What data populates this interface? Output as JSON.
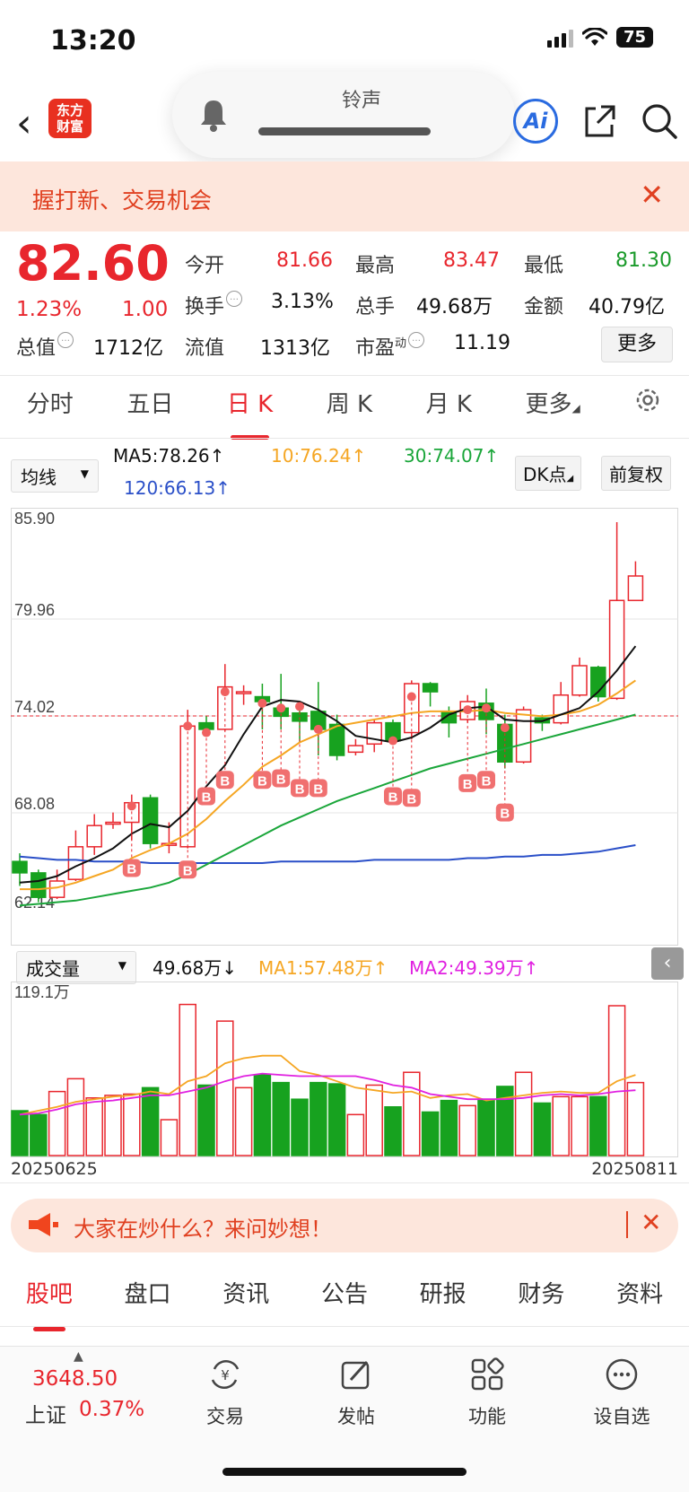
{
  "status": {
    "time": "13:20",
    "battery": "75"
  },
  "header": {
    "logo_line1": "东方",
    "logo_line2": "财富",
    "ringer_label": "铃声",
    "ai_label": "Ai"
  },
  "banner": {
    "text": "握打新、交易机会"
  },
  "quote": {
    "price": "82.60",
    "pct": "1.23%",
    "change": "1.00",
    "open_label": "今开",
    "open": "81.66",
    "high_label": "最高",
    "high": "83.47",
    "low_label": "最低",
    "low": "81.30",
    "turnover_label": "换手",
    "turnover": "3.13%",
    "volume_label": "总手",
    "volume": "49.68万",
    "amount_label": "金额",
    "amount": "40.79亿",
    "mktcap_label": "总值",
    "mktcap": "1712亿",
    "float_label": "流值",
    "float": "1313亿",
    "pe_label": "市盈",
    "pe_sup": "动",
    "pe": "11.19",
    "more": "更多"
  },
  "tabs": [
    {
      "label": "分时"
    },
    {
      "label": "五日"
    },
    {
      "label": "日 K"
    },
    {
      "label": "周 K"
    },
    {
      "label": "月 K"
    },
    {
      "label": "更多"
    }
  ],
  "chart_ctrl": {
    "ma_select": "均线",
    "ma5": "MA5:78.26↑",
    "ma10": "10:76.24↑",
    "ma30": "30:74.07↑",
    "ma120": "120:66.13↑",
    "dk": "DK点",
    "adjust": "前复权"
  },
  "colors": {
    "up": "#e8262d",
    "down": "#17a21f",
    "ma5": "#111111",
    "ma10": "#f5a623",
    "ma30": "#1aa63a",
    "ma120": "#2a4fc8",
    "vma2": "#e020e0"
  },
  "chart_data": {
    "type": "candlestick",
    "price_axis": {
      "ticks": [
        "85.90",
        "79.96",
        "74.02",
        "68.08",
        "62.14"
      ],
      "ylim": [
        62.14,
        85.9
      ],
      "ref_price": 74.02
    },
    "candles": [
      [
        65.1,
        64.4,
        63.6,
        65.6
      ],
      [
        64.4,
        62.9,
        62.6,
        64.6
      ],
      [
        62.9,
        63.9,
        62.8,
        64.6
      ],
      [
        64.0,
        66.0,
        63.9,
        67.0
      ],
      [
        66.0,
        67.3,
        65.5,
        68.0
      ],
      [
        67.4,
        67.5,
        67.1,
        68.1
      ],
      [
        67.5,
        68.7,
        66.4,
        69.2
      ],
      [
        69.0,
        66.2,
        65.9,
        69.2
      ],
      [
        66.2,
        66.2,
        65.6,
        67.5
      ],
      [
        66.0,
        73.4,
        65.9,
        74.4
      ],
      [
        73.6,
        73.2,
        72.9,
        74.0
      ],
      [
        73.2,
        75.8,
        73.1,
        77.2
      ],
      [
        75.5,
        75.5,
        74.7,
        75.9
      ],
      [
        75.2,
        74.9,
        73.2,
        76.0
      ],
      [
        74.5,
        74.0,
        73.2,
        76.6
      ],
      [
        74.2,
        73.7,
        72.4,
        74.6
      ],
      [
        74.3,
        73.2,
        71.6,
        76.1
      ],
      [
        73.5,
        71.6,
        71.3,
        74.1
      ],
      [
        71.8,
        72.2,
        71.6,
        72.6
      ],
      [
        72.3,
        73.6,
        71.8,
        73.8
      ],
      [
        73.6,
        72.5,
        72.3,
        73.8
      ],
      [
        73.0,
        76.0,
        72.6,
        76.2
      ],
      [
        76.0,
        75.5,
        74.6,
        76.1
      ],
      [
        74.3,
        73.6,
        72.7,
        74.6
      ],
      [
        73.8,
        74.9,
        73.6,
        75.3
      ],
      [
        74.8,
        73.8,
        72.9,
        75.7
      ],
      [
        73.5,
        71.2,
        70.8,
        74.1
      ],
      [
        71.2,
        74.4,
        71.1,
        74.6
      ],
      [
        73.9,
        73.6,
        73.1,
        74.1
      ],
      [
        73.6,
        75.3,
        73.5,
        76.1
      ],
      [
        75.3,
        77.1,
        75.2,
        77.6
      ],
      [
        77.0,
        75.2,
        74.9,
        77.1
      ],
      [
        75.1,
        81.1,
        75.0,
        85.9
      ],
      [
        81.1,
        82.6,
        81.3,
        83.5
      ]
    ],
    "ma5": [
      63.8,
      63.9,
      64.2,
      64.8,
      65.3,
      65.9,
      66.8,
      67.4,
      67.2,
      68.2,
      69.7,
      71.0,
      72.9,
      74.6,
      75.0,
      74.9,
      74.4,
      73.7,
      72.8,
      72.6,
      72.4,
      72.7,
      73.3,
      74.1,
      74.5,
      74.6,
      73.8,
      73.7,
      73.7,
      74.1,
      74.5,
      75.5,
      76.8,
      78.3
    ],
    "ma10": [
      63.4,
      63.4,
      63.5,
      63.8,
      64.2,
      64.6,
      65.3,
      65.8,
      66.2,
      66.8,
      67.7,
      68.8,
      69.8,
      70.9,
      71.6,
      72.4,
      72.9,
      73.4,
      73.6,
      73.8,
      74.0,
      74.2,
      74.3,
      74.3,
      74.3,
      74.4,
      74.2,
      74.1,
      74.0,
      74.1,
      74.3,
      74.7,
      75.4,
      76.2
    ],
    "ma30": [
      62.4,
      62.5,
      62.6,
      62.7,
      62.9,
      63.1,
      63.3,
      63.5,
      63.8,
      64.3,
      64.9,
      65.5,
      66.1,
      66.7,
      67.3,
      67.8,
      68.3,
      68.8,
      69.2,
      69.6,
      70.0,
      70.4,
      70.8,
      71.1,
      71.4,
      71.7,
      72.0,
      72.3,
      72.6,
      72.9,
      73.2,
      73.5,
      73.8,
      74.1
    ],
    "ma120": [
      65.4,
      65.3,
      65.2,
      65.2,
      65.1,
      65.1,
      65.1,
      65.0,
      65.0,
      65.0,
      65.0,
      65.0,
      65.0,
      65.0,
      65.1,
      65.1,
      65.1,
      65.1,
      65.1,
      65.2,
      65.2,
      65.2,
      65.2,
      65.2,
      65.3,
      65.3,
      65.4,
      65.4,
      65.5,
      65.5,
      65.6,
      65.7,
      65.9,
      66.1
    ],
    "b_signals": [
      {
        "i": 6,
        "price": 68.5,
        "label_price": 64.7
      },
      {
        "i": 9,
        "price": 73.4,
        "label_price": 64.6
      },
      {
        "i": 10,
        "price": 73.0,
        "label_price": 69.1
      },
      {
        "i": 11,
        "price": 75.5,
        "label_price": 70.1
      },
      {
        "i": 13,
        "price": 74.8,
        "label_price": 70.1
      },
      {
        "i": 14,
        "price": 74.5,
        "label_price": 70.2
      },
      {
        "i": 15,
        "price": 74.6,
        "label_price": 69.6
      },
      {
        "i": 16,
        "price": 73.2,
        "label_price": 69.6
      },
      {
        "i": 20,
        "price": 72.5,
        "label_price": 69.1
      },
      {
        "i": 21,
        "price": 75.2,
        "label_price": 69.0
      },
      {
        "i": 24,
        "price": 74.4,
        "label_price": 69.9
      },
      {
        "i": 25,
        "price": 74.5,
        "label_price": 70.1
      },
      {
        "i": 26,
        "price": 73.3,
        "label_price": 68.1
      }
    ],
    "volume_panel": {
      "select": "成交量",
      "current": "49.68万↓",
      "ma1": "MA1:57.48万↑",
      "ma2": "MA2:49.39万↑",
      "max_label": "119.1万",
      "ymax": 119.1,
      "volumes": [
        35,
        32,
        50,
        60,
        45,
        47,
        48,
        53,
        28,
        118,
        55,
        105,
        53,
        63,
        57,
        44,
        57,
        56,
        32,
        55,
        38,
        65,
        34,
        43,
        39,
        44,
        54,
        65,
        41,
        46,
        46,
        46,
        117,
        57
      ],
      "vma1": [
        32,
        35,
        38,
        42,
        44,
        46,
        47,
        50,
        48,
        58,
        62,
        72,
        76,
        78,
        78,
        66,
        63,
        58,
        53,
        51,
        49,
        50,
        45,
        47,
        48,
        43,
        45,
        47,
        49,
        50,
        49,
        49,
        58,
        63
      ],
      "vma2": [
        32,
        33,
        36,
        40,
        42,
        43,
        45,
        47,
        47,
        50,
        53,
        58,
        62,
        64,
        63,
        62,
        62,
        62,
        62,
        59,
        55,
        53,
        48,
        46,
        44,
        44,
        44,
        45,
        47,
        48,
        47,
        48,
        50,
        51
      ],
      "start_date": "20250625",
      "end_date": "20250811"
    }
  },
  "promo": {
    "text": "大家在炒什么？来问妙想！"
  },
  "bottom_tabs": [
    {
      "label": "股吧"
    },
    {
      "label": "盘口"
    },
    {
      "label": "资讯"
    },
    {
      "label": "公告"
    },
    {
      "label": "研报"
    },
    {
      "label": "财务"
    },
    {
      "label": "资料"
    }
  ],
  "nav": {
    "index_value": "3648.50",
    "index_name": "上证",
    "index_pct": "0.37%",
    "items": [
      {
        "label": "交易"
      },
      {
        "label": "发帖"
      },
      {
        "label": "功能"
      },
      {
        "label": "设自选"
      }
    ]
  }
}
